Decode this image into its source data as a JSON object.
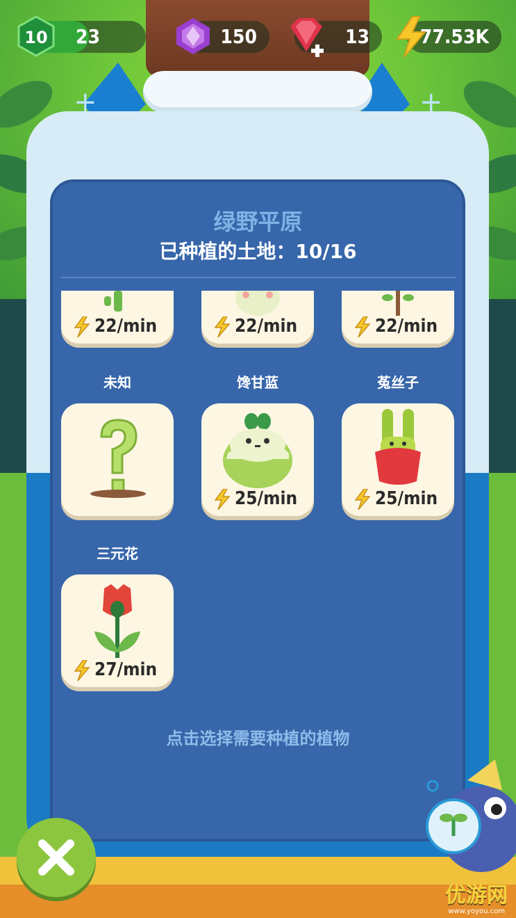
{
  "hud": {
    "level": "10",
    "level_progress_value": "23",
    "level_progress_fraction": 0.55,
    "gems": "150",
    "rubies": "13",
    "energy": "77.53K"
  },
  "panel": {
    "region_name": "绿野平原",
    "planted_land": "已种植的土地：10/16",
    "hint": "点击选择需要种植的植物"
  },
  "plants_row_top": [
    {
      "rate": "22/min"
    },
    {
      "rate": "22/min"
    },
    {
      "rate": "22/min"
    }
  ],
  "plants": [
    {
      "name": "未知",
      "rate": "",
      "icon": "question-mark-icon"
    },
    {
      "name": "馋甘蓝",
      "rate": "25/min",
      "icon": "cabbage-icon"
    },
    {
      "name": "菟丝子",
      "rate": "25/min",
      "icon": "dodder-icon"
    },
    {
      "name": "三元花",
      "rate": "27/min",
      "icon": "tulip-icon"
    }
  ],
  "watermark": {
    "text": "优游网",
    "sub": "www.yoyou.com"
  },
  "colors": {
    "panel": "#3766aa",
    "card": "#fdf6e3",
    "close_button": "#8cc63f",
    "bolt": "#f7c72a"
  }
}
